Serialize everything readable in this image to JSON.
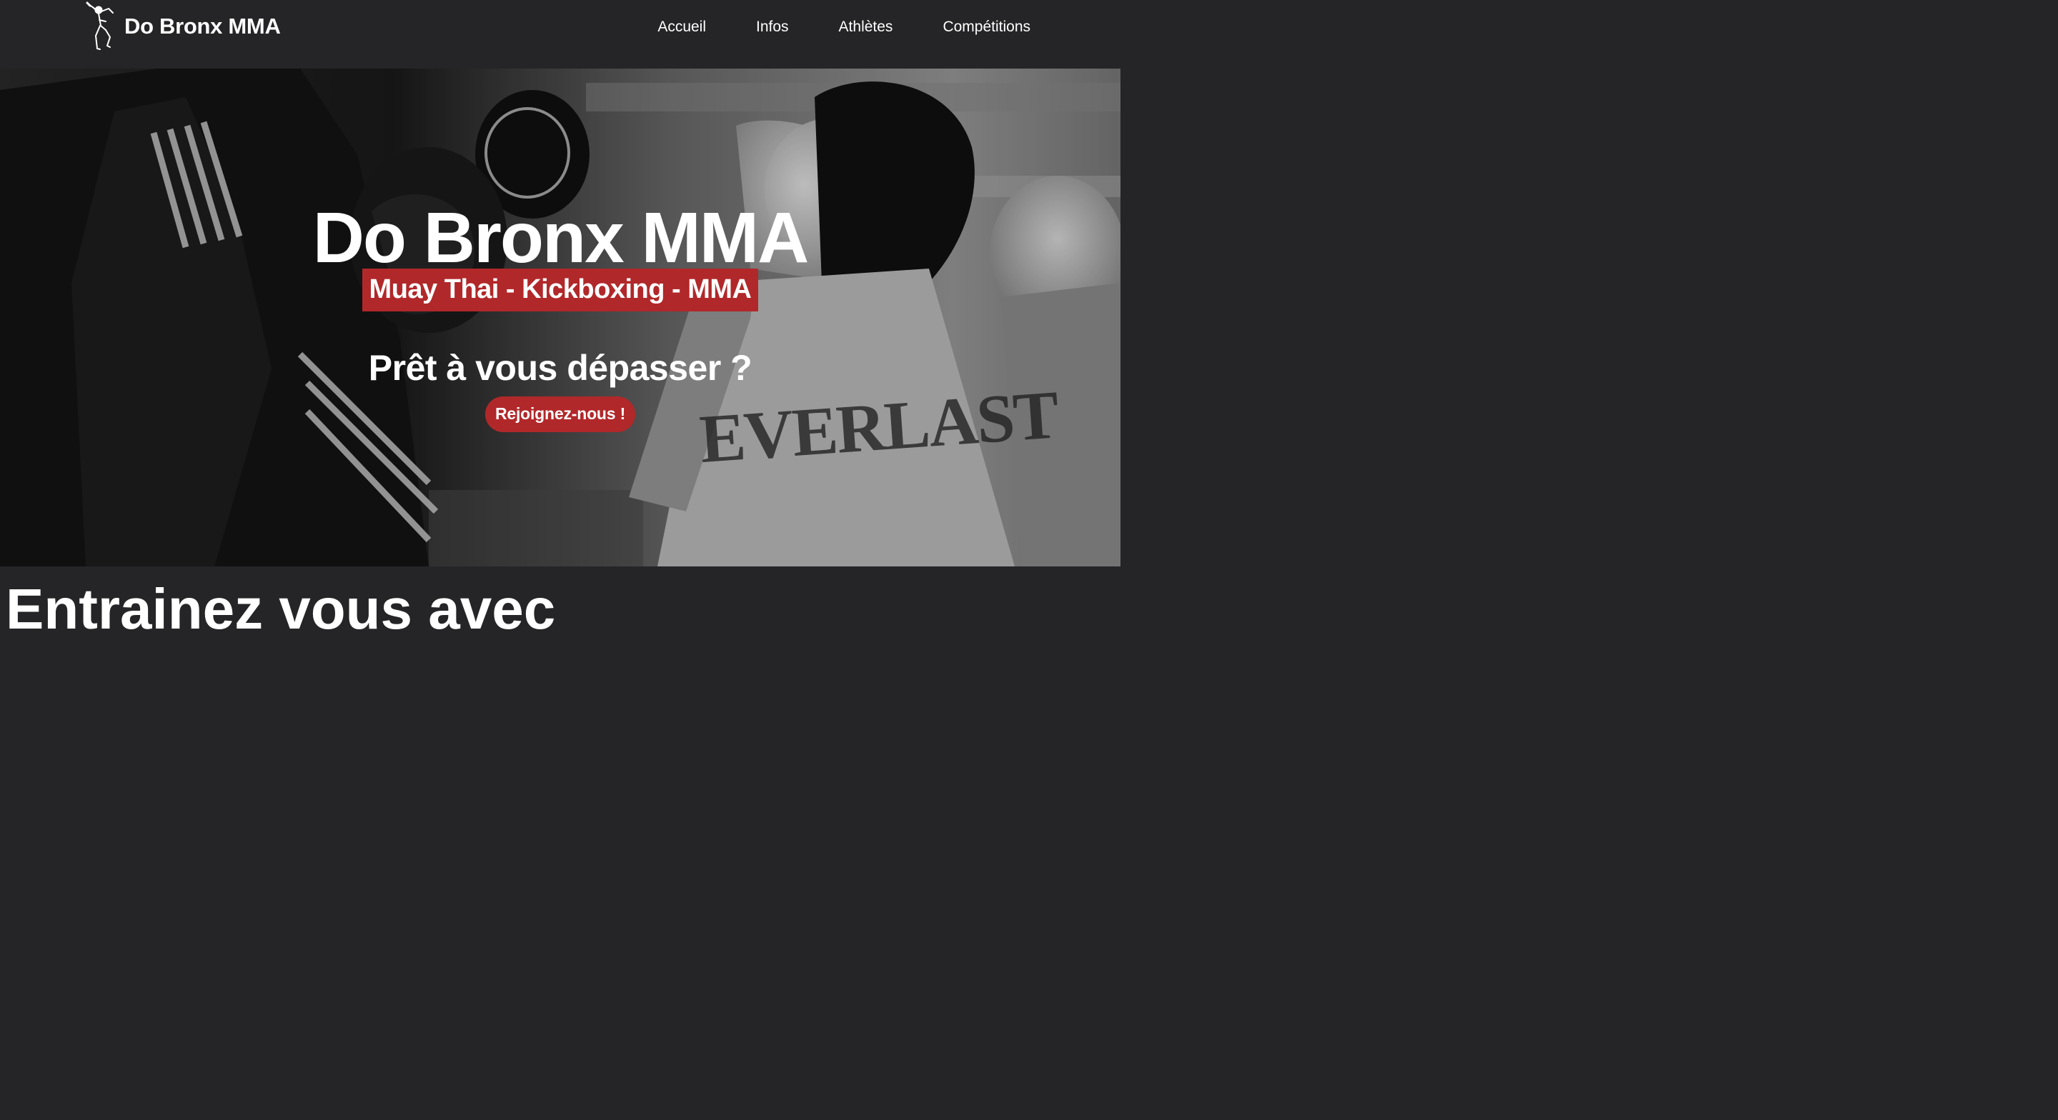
{
  "navbar": {
    "brand_name": "Do Bronx MMA",
    "logo_icon": "muay-thai-fighter-logo",
    "links": [
      {
        "label": "Accueil"
      },
      {
        "label": "Infos"
      },
      {
        "label": "Athlètes"
      },
      {
        "label": "Compétitions"
      }
    ]
  },
  "hero": {
    "title": "Do Bronx MMA",
    "subtitle": "Muay Thai - Kickboxing - MMA",
    "cta_text": "Prêt à vous dépasser ?",
    "cta_button": "Rejoignez-nous !",
    "background_image": "black-and-white-boxing-training-photo"
  },
  "section": {
    "title": "Entrainez vous avec"
  },
  "colors": {
    "navbar_bg": "#252527",
    "accent_red": "#b1282a",
    "text": "#ffffff"
  }
}
